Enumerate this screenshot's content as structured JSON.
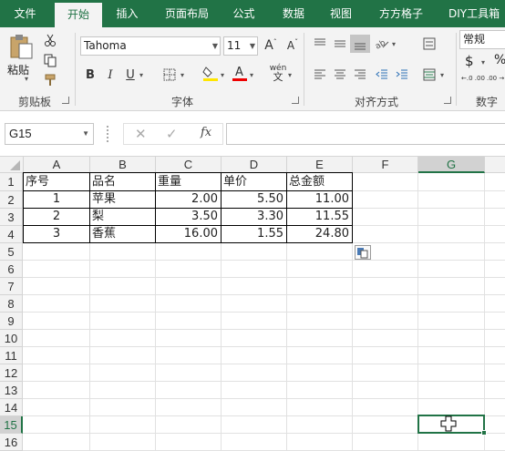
{
  "tabs": [
    "文件",
    "开始",
    "插入",
    "页面布局",
    "公式",
    "数据",
    "视图",
    "方方格子",
    "DIY工具箱"
  ],
  "ribbon": {
    "paste_label": "粘贴",
    "font_name": "Tahoma",
    "font_size": "11",
    "bold": "B",
    "italic": "I",
    "underline": "U",
    "font_grow": "A",
    "font_shrink": "A",
    "phonetic": "wén",
    "number_format": "常规",
    "currency": "$",
    "percent": "%",
    "dec_inc": "←.0 .00",
    "dec_dec": ".00 →.0",
    "groups": [
      "剪贴板",
      "字体",
      "对齐方式",
      "数字"
    ]
  },
  "formula_bar": {
    "name_box": "G15",
    "fx": "fx",
    "formula": ""
  },
  "columns": [
    "A",
    "B",
    "C",
    "D",
    "E",
    "F",
    "G"
  ],
  "rows": [
    "1",
    "2",
    "3",
    "4",
    "5",
    "6",
    "7",
    "8",
    "9",
    "10",
    "11",
    "12",
    "13",
    "14",
    "15",
    "16"
  ],
  "table": {
    "header": [
      "序号",
      "品名",
      "重量",
      "单价",
      "总金额"
    ],
    "rows": [
      [
        "1",
        "苹果",
        "2.00",
        "5.50",
        "11.00"
      ],
      [
        "2",
        "梨",
        "3.50",
        "3.30",
        "11.55"
      ],
      [
        "3",
        "香蕉",
        "16.00",
        "1.55",
        "24.80"
      ]
    ]
  },
  "selected_cell": "G15",
  "colors": {
    "accent": "#217346",
    "tab_bg": "#217346"
  }
}
